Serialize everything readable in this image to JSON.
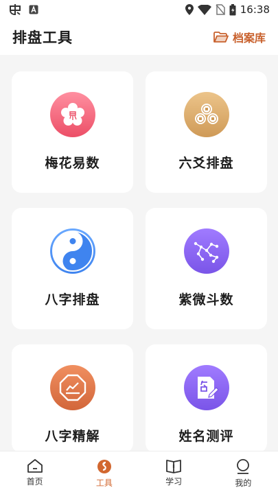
{
  "status_bar": {
    "time": "16:38",
    "left_icons": [
      "app-notification-icon",
      "a-letter-icon"
    ],
    "right_icons": [
      "location-icon",
      "wifi-icon",
      "no-sim-icon",
      "battery-icon"
    ]
  },
  "header": {
    "title": "排盘工具",
    "archive_label": "档案库",
    "archive_icon": "folder-open-icon",
    "accent_color": "#c8602c"
  },
  "tools": [
    {
      "label": "梅花易数",
      "icon": "plum-blossom-icon",
      "color_top": "#ff8fa0",
      "color_bottom": "#ec4f67"
    },
    {
      "label": "六爻排盘",
      "icon": "coins-icon",
      "color_top": "#ecc48a",
      "color_bottom": "#cf9a57"
    },
    {
      "label": "八字排盘",
      "icon": "yin-yang-icon",
      "color_top": "#6aa9ff",
      "color_bottom": "#3f84ef"
    },
    {
      "label": "紫微斗数",
      "icon": "constellation-icon",
      "color_top": "#a07bff",
      "color_bottom": "#7a55e8"
    },
    {
      "label": "八字精解",
      "icon": "octagon-chart-icon",
      "color_top": "#f08f60",
      "color_bottom": "#d2663a"
    },
    {
      "label": "姓名测评",
      "icon": "name-card-icon",
      "color_top": "#a07bff",
      "color_bottom": "#7a55e8"
    }
  ],
  "tabbar": {
    "active_color": "#d2672f",
    "items": [
      {
        "label": "首页",
        "icon": "home-icon",
        "active": false
      },
      {
        "label": "工具",
        "icon": "tools-icon",
        "active": true
      },
      {
        "label": "学习",
        "icon": "book-icon",
        "active": false
      },
      {
        "label": "我的",
        "icon": "profile-icon",
        "active": false
      }
    ]
  }
}
